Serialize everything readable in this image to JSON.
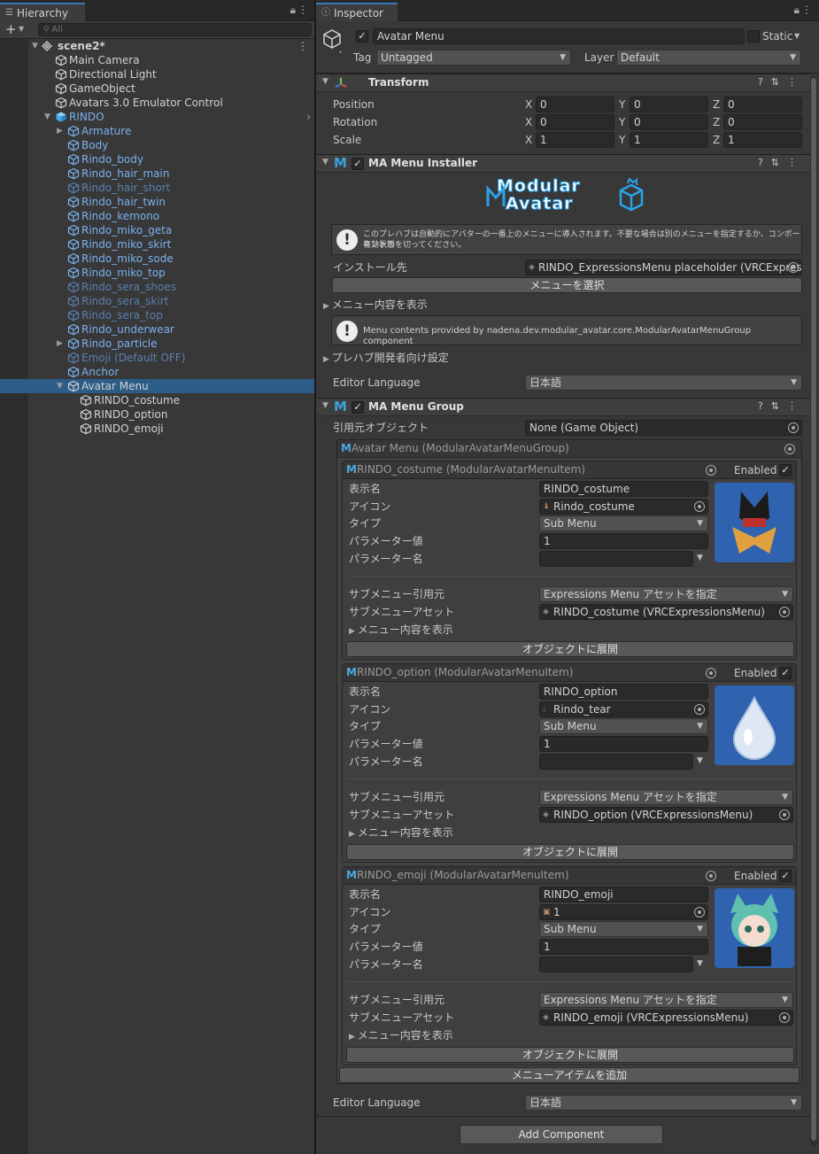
{
  "hierarchy": {
    "tab_title": "Hierarchy",
    "search_placeholder": "All",
    "scene": "scene2*",
    "items": [
      {
        "label": "Main Camera"
      },
      {
        "label": "Directional Light"
      },
      {
        "label": "GameObject"
      },
      {
        "label": "Avatars 3.0 Emulator Control"
      },
      {
        "label": "RINDO"
      },
      {
        "label": "Armature"
      },
      {
        "label": "Body"
      },
      {
        "label": "Rindo_body"
      },
      {
        "label": "Rindo_hair_main"
      },
      {
        "label": "Rindo_hair_short"
      },
      {
        "label": "Rindo_hair_twin"
      },
      {
        "label": "Rindo_kemono"
      },
      {
        "label": "Rindo_miko_geta"
      },
      {
        "label": "Rindo_miko_skirt"
      },
      {
        "label": "Rindo_miko_sode"
      },
      {
        "label": "Rindo_miko_top"
      },
      {
        "label": "Rindo_sera_shoes"
      },
      {
        "label": "Rindo_sera_skirt"
      },
      {
        "label": "Rindo_sera_top"
      },
      {
        "label": "Rindo_underwear"
      },
      {
        "label": "Rindo_particle"
      },
      {
        "label": "Emoji (Default OFF)"
      },
      {
        "label": "Anchor"
      },
      {
        "label": "Avatar Menu"
      },
      {
        "label": "RINDO_costume"
      },
      {
        "label": "RINDO_option"
      },
      {
        "label": "RINDO_emoji"
      }
    ]
  },
  "inspector": {
    "tab_title": "Inspector",
    "object_name": "Avatar Menu",
    "static_label": "Static",
    "tag_label": "Tag",
    "tag_value": "Untagged",
    "layer_label": "Layer",
    "layer_value": "Default",
    "transform": {
      "title": "Transform",
      "position_label": "Position",
      "rotation_label": "Rotation",
      "scale_label": "Scale",
      "axes": [
        "X",
        "Y",
        "Z"
      ],
      "position": [
        "0",
        "0",
        "0"
      ],
      "rotation": [
        "0",
        "0",
        "0"
      ],
      "scale": [
        "1",
        "1",
        "1"
      ]
    },
    "installer": {
      "title": "MA Menu Installer",
      "logo_line1": "Modular",
      "logo_line2": "Avatar",
      "help1_line1": "このプレハブは自動的にアバターの一番上のメニューに導入されます。不要な場合は別のメニューを指定するか、コンポーネントの",
      "help1_line2": "有効状態を切ってください。",
      "install_to_label": "インストール先",
      "install_to_value": "RINDO_ExpressionsMenu placeholder (VRCExpres",
      "select_menu_button": "メニューを選択",
      "show_menu_contents": "メニュー内容を表示",
      "help2": "Menu contents provided by nadena.dev.modular_avatar.core.ModularAvatarMenuGroup component",
      "prefab_dev_settings": "プレハブ開発者向け設定",
      "editor_language_label": "Editor Language",
      "editor_language_value": "日本語"
    },
    "group": {
      "title": "MA Menu Group",
      "source_label": "引用元オブジェクト",
      "source_value": "None (Game Object)",
      "outer_title": "Avatar Menu (ModularAvatarMenuGroup)",
      "items": [
        {
          "header": "RINDO_costume (ModularAvatarMenuItem)",
          "enabled": "Enabled",
          "name_label": "表示名",
          "name": "RINDO_costume",
          "icon_label": "アイコン",
          "icon": "Rindo_costume",
          "type_label": "タイプ",
          "type": "Sub Menu",
          "param_value_label": "パラメーター値",
          "param_value": "1",
          "param_name_label": "パラメーター名",
          "src_label": "サブメニュー引用元",
          "src": "Expressions Menu アセットを指定",
          "asset_label": "サブメニューアセット",
          "asset": "RINDO_costume (VRCExpressionsMenu)",
          "show_contents": "メニュー内容を表示",
          "expand_button": "オブジェクトに展開"
        },
        {
          "header": "RINDO_option (ModularAvatarMenuItem)",
          "enabled": "Enabled",
          "name_label": "表示名",
          "name": "RINDO_option",
          "icon_label": "アイコン",
          "icon": "Rindo_tear",
          "type_label": "タイプ",
          "type": "Sub Menu",
          "param_value_label": "パラメーター値",
          "param_value": "1",
          "param_name_label": "パラメーター名",
          "src_label": "サブメニュー引用元",
          "src": "Expressions Menu アセットを指定",
          "asset_label": "サブメニューアセット",
          "asset": "RINDO_option (VRCExpressionsMenu)",
          "show_contents": "メニュー内容を表示",
          "expand_button": "オブジェクトに展開"
        },
        {
          "header": "RINDO_emoji (ModularAvatarMenuItem)",
          "enabled": "Enabled",
          "name_label": "表示名",
          "name": "RINDO_emoji",
          "icon_label": "アイコン",
          "icon": "1",
          "type_label": "タイプ",
          "type": "Sub Menu",
          "param_value_label": "パラメーター値",
          "param_value": "1",
          "param_name_label": "パラメーター名",
          "src_label": "サブメニュー引用元",
          "src": "Expressions Menu アセットを指定",
          "asset_label": "サブメニューアセット",
          "asset": "RINDO_emoji (VRCExpressionsMenu)",
          "show_contents": "メニュー内容を表示",
          "expand_button": "オブジェクトに展開"
        }
      ],
      "add_item_button": "メニューアイテムを追加",
      "editor_language_label": "Editor Language",
      "editor_language_value": "日本語"
    },
    "add_component_button": "Add Component"
  }
}
